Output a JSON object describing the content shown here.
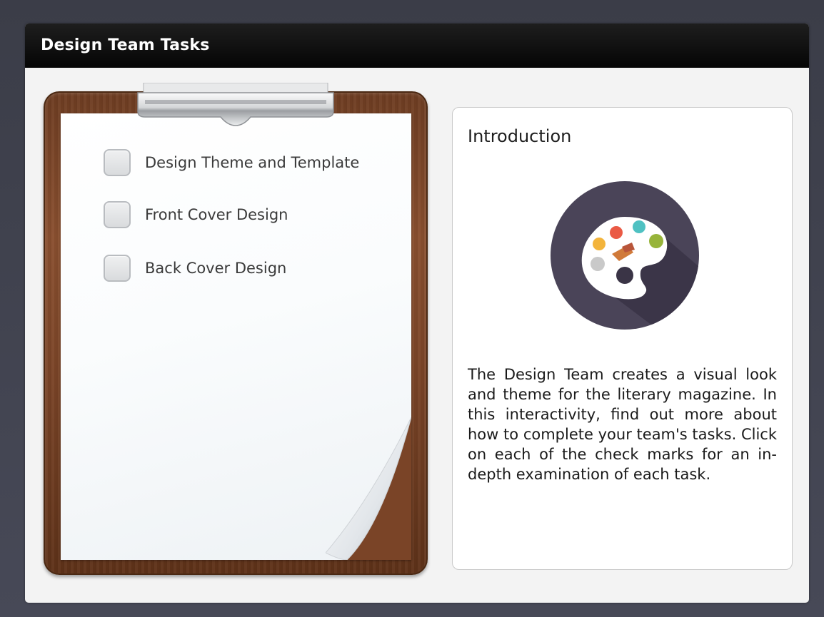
{
  "window": {
    "title": "Design Team Tasks"
  },
  "tasks": [
    {
      "label": "Design Theme and Template",
      "checked": false
    },
    {
      "label": "Front Cover Design",
      "checked": false
    },
    {
      "label": "Back Cover Design",
      "checked": false
    }
  ],
  "intro": {
    "title": "Introduction",
    "icon": "palette-icon",
    "body": "The Design Team creates a visual look and theme for the literary magazine. In this interactivity, find out more about how to complete your team's tasks. Click on each of the check marks for an in-depth examination of each task."
  },
  "colors": {
    "titlebar": "#0a0a0a",
    "clipboard_wood": "#7a4427",
    "icon_circle": "#4a4458"
  }
}
